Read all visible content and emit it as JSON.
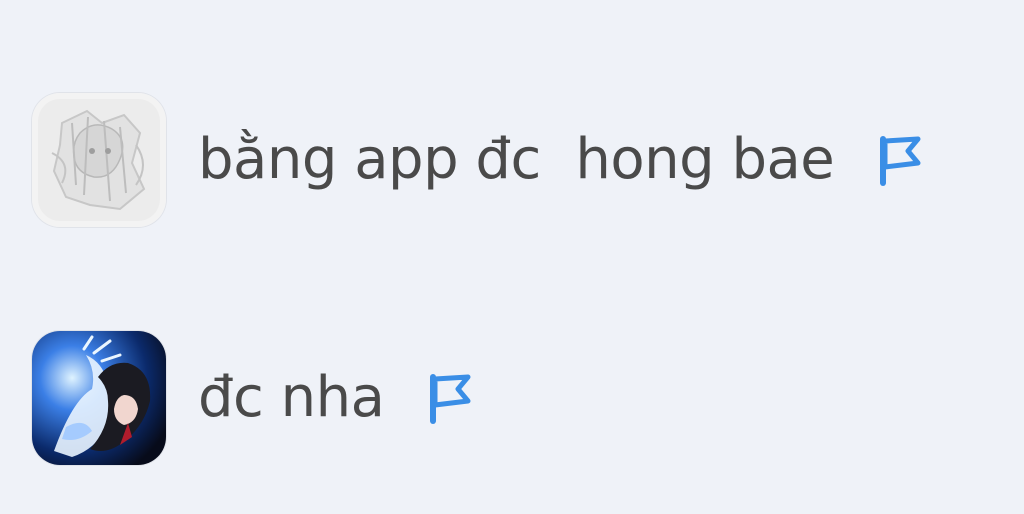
{
  "comments": [
    {
      "text": "bằng app đc  hong bae",
      "flag_icon": "flag-icon",
      "accent": "#3a8ee6"
    },
    {
      "text": "đc nha",
      "flag_icon": "flag-icon",
      "accent": "#3a8ee6"
    }
  ]
}
